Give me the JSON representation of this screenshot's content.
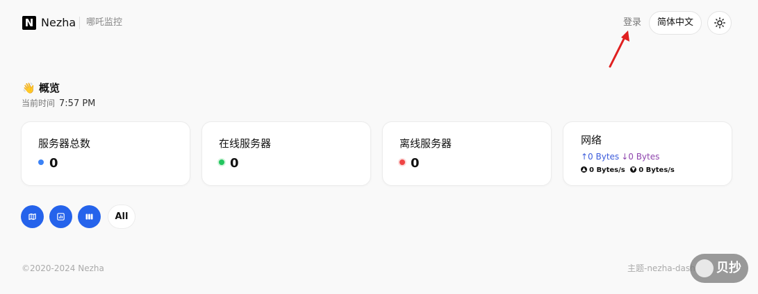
{
  "header": {
    "logo_letter": "N",
    "brand": "Nezha",
    "subtitle": "哪吒监控",
    "login": "登录",
    "language": "简体中文",
    "theme_icon": "sun-icon"
  },
  "overview": {
    "emoji": "👋",
    "title": "概览",
    "time_label": "当前时间",
    "time_value": "7:57 PM"
  },
  "cards": {
    "total": {
      "label": "服务器总数",
      "value": "0",
      "dot_color": "#3b82f6"
    },
    "online": {
      "label": "在线服务器",
      "value": "0",
      "dot_color": "#22c55e"
    },
    "offline": {
      "label": "离线服务器",
      "value": "0",
      "dot_color": "#ef4444"
    },
    "network": {
      "label": "网络",
      "upload_speed": "↑0 Bytes",
      "download_speed": "↓0 Bytes",
      "upload_total": "0 Bytes/s",
      "download_total": "0 Bytes/s"
    }
  },
  "views": {
    "map_icon": "map-icon",
    "chart_icon": "chart-icon",
    "columns_icon": "columns-icon",
    "all_label": "All"
  },
  "footer": {
    "copyright": "©2020-2024 Nezha",
    "theme_credit": "主题-nezha-dash",
    "watermark": "贝抄"
  },
  "colors": {
    "accent": "#2563eb",
    "annotation_arrow": "#e02020"
  }
}
